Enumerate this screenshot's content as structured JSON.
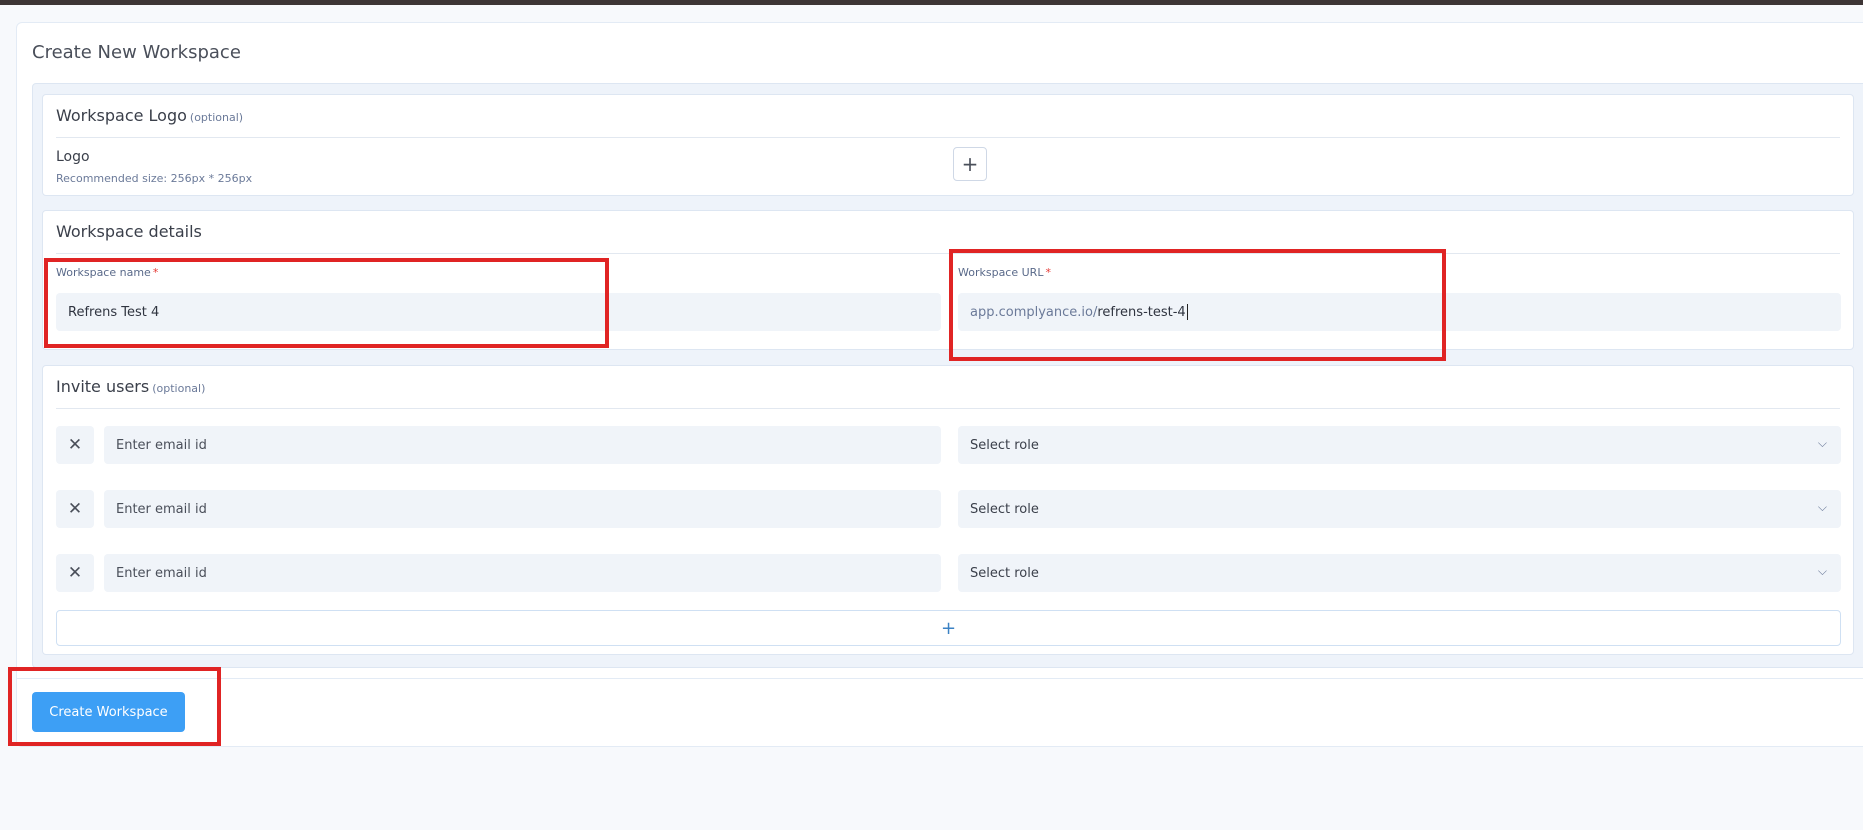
{
  "page": {
    "title": "Create New Workspace"
  },
  "logo_section": {
    "title": "Workspace Logo",
    "optional": "(optional)",
    "label": "Logo",
    "hint": "Recommended size: 256px * 256px",
    "add_icon": "+"
  },
  "details_section": {
    "title": "Workspace details",
    "name_label": "Workspace name",
    "name_value": "Refrens Test 4",
    "url_label": "Workspace URL",
    "url_prefix": "app.complyance.io/",
    "url_value": "refrens-test-4",
    "required_mark": "*"
  },
  "invite_section": {
    "title": "Invite users",
    "optional": "(optional)",
    "rows": [
      {
        "email_placeholder": "Enter email id",
        "role": "Select role"
      },
      {
        "email_placeholder": "Enter email id",
        "role": "Select role"
      },
      {
        "email_placeholder": "Enter email id",
        "role": "Select role"
      }
    ],
    "remove_icon": "✕",
    "chevron_icon": "⌵",
    "add_icon": "+"
  },
  "actions": {
    "create_label": "Create Workspace"
  },
  "colors": {
    "accent": "#3d9ff5",
    "highlight": "#e02424",
    "required": "#e53935"
  }
}
